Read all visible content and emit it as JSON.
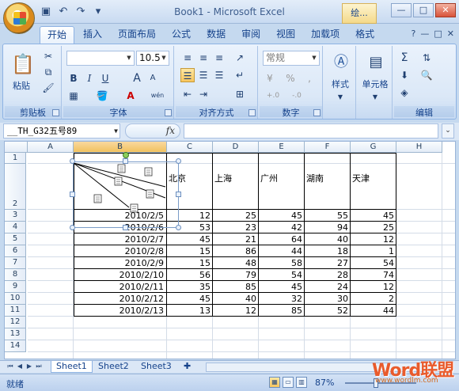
{
  "window": {
    "title": "Book1 - Microsoft Excel",
    "context_tab": "绘...",
    "controls": [
      "—",
      "□",
      "✕"
    ]
  },
  "quick_access": [
    "save-icon",
    "undo-icon",
    "redo-icon",
    "customize-icon"
  ],
  "tabs": [
    {
      "label": "开始",
      "active": true
    },
    {
      "label": "插入"
    },
    {
      "label": "页面布局"
    },
    {
      "label": "公式"
    },
    {
      "label": "数据"
    },
    {
      "label": "审阅"
    },
    {
      "label": "视图"
    },
    {
      "label": "加载项"
    },
    {
      "label": "格式"
    }
  ],
  "tab_right": [
    "?",
    "—",
    "□",
    "✕"
  ],
  "ribbon": {
    "clipboard": {
      "label": "剪贴板",
      "paste": "粘贴"
    },
    "font": {
      "label": "字体",
      "name": "",
      "size": "10.5",
      "bold": "B",
      "italic": "I",
      "underline": "U",
      "grow": "A",
      "shrink": "A",
      "font_color": "A",
      "phonetic": "wén"
    },
    "alignment": {
      "label": "对齐方式"
    },
    "number": {
      "label": "数字",
      "format": "常规",
      "percent": "%",
      "comma": ",",
      "inc": "+.0",
      "dec": "-.0"
    },
    "styles": {
      "label": "样式"
    },
    "cells": {
      "label": "单元格"
    },
    "editing": {
      "label": "编辑",
      "sum": "Σ"
    }
  },
  "formula_bar": {
    "name_box": "__TH_G32五号89",
    "fx": "fx",
    "content": ""
  },
  "columns": [
    "A",
    "B",
    "C",
    "D",
    "E",
    "F",
    "G",
    "H"
  ],
  "rows": [
    "1",
    "2",
    "3",
    "4",
    "5",
    "6",
    "7",
    "8",
    "9",
    "10",
    "11",
    "12",
    "13",
    "14"
  ],
  "table": {
    "header_cities": [
      "北京",
      "上海",
      "广州",
      "湖南",
      "天津"
    ],
    "rows": [
      {
        "date": "2010/2/5",
        "values": [
          "12",
          "25",
          "45",
          "55",
          "45"
        ]
      },
      {
        "date": "2010/2/6",
        "values": [
          "53",
          "23",
          "42",
          "94",
          "25"
        ]
      },
      {
        "date": "2010/2/7",
        "values": [
          "45",
          "21",
          "64",
          "40",
          "12"
        ]
      },
      {
        "date": "2010/2/8",
        "values": [
          "15",
          "86",
          "44",
          "18",
          "1"
        ]
      },
      {
        "date": "2010/2/9",
        "values": [
          "15",
          "48",
          "58",
          "27",
          "54"
        ]
      },
      {
        "date": "2010/2/10",
        "values": [
          "56",
          "79",
          "54",
          "28",
          "74"
        ]
      },
      {
        "date": "2010/2/11",
        "values": [
          "35",
          "85",
          "45",
          "24",
          "12"
        ]
      },
      {
        "date": "2010/2/12",
        "values": [
          "45",
          "40",
          "32",
          "30",
          "2"
        ]
      },
      {
        "date": "2010/2/13",
        "values": [
          "13",
          "12",
          "85",
          "52",
          "44"
        ]
      }
    ]
  },
  "sheets": [
    {
      "label": "Sheet1",
      "active": true
    },
    {
      "label": "Sheet2"
    },
    {
      "label": "Sheet3"
    }
  ],
  "status": {
    "ready": "就绪",
    "zoom": "87%",
    "zoom_level": 0.87
  },
  "watermark": {
    "brand": "Word联盟",
    "url": "www.wordlm.com"
  },
  "colors": {
    "ribbon_bg": "#dbe8f7",
    "accent": "#15428b",
    "selection_orange": "#f7c55d",
    "watermark": "#e95b2c"
  }
}
